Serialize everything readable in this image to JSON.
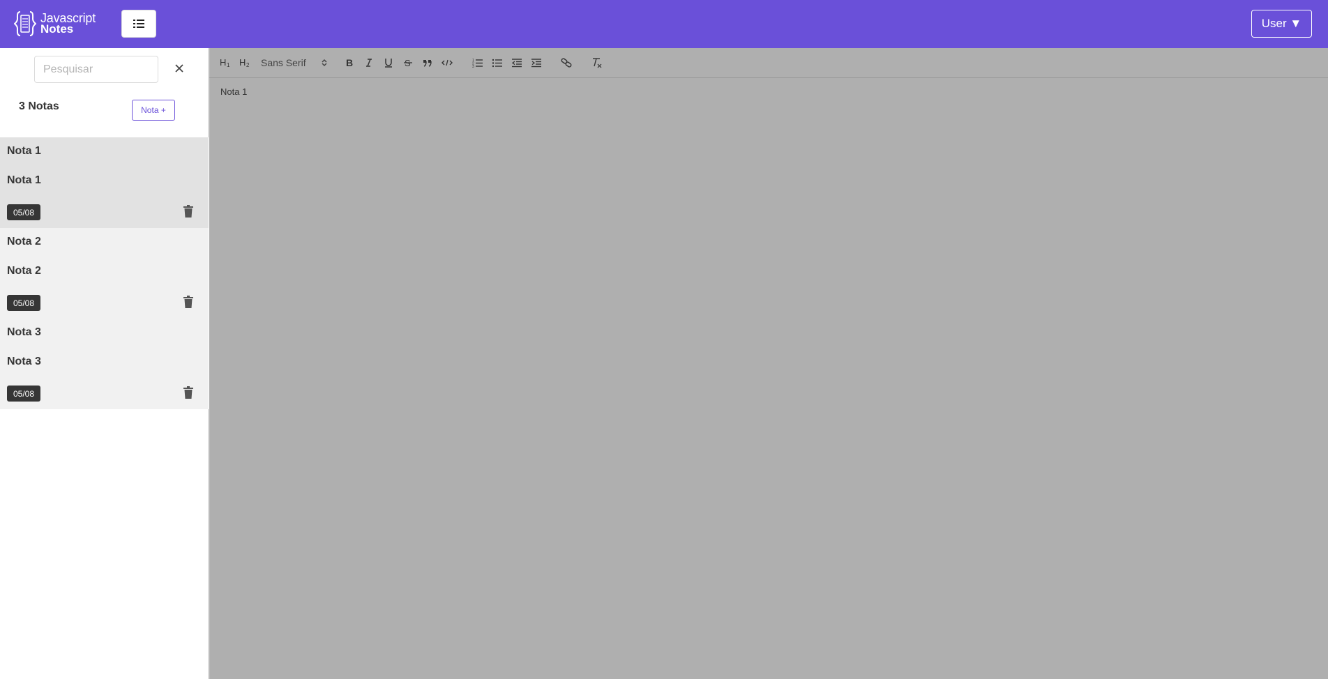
{
  "header": {
    "logo_line1": "Javascript",
    "logo_line2": "Notes",
    "menu_icon": "list-icon",
    "user_label": "User ▼"
  },
  "sidebar": {
    "search_placeholder": "Pesquisar",
    "notes_count_label": "3 Notas",
    "new_note_label": "Nota +",
    "notes": [
      {
        "title": "Nota 1",
        "excerpt": "Nota 1",
        "date": "05/08",
        "active": true
      },
      {
        "title": "Nota 2",
        "excerpt": "Nota 2",
        "date": "05/08",
        "active": false
      },
      {
        "title": "Nota 3",
        "excerpt": "Nota 3",
        "date": "05/08",
        "active": false
      }
    ]
  },
  "editor": {
    "font_family_option": "Sans Serif",
    "content": "Nota 1",
    "toolbar_icons": [
      "header1-icon",
      "header2-icon",
      "bold-icon",
      "italic-icon",
      "underline-icon",
      "strike-icon",
      "blockquote-icon",
      "code-block-icon",
      "ordered-list-icon",
      "bullet-list-icon",
      "indent-decrease-icon",
      "indent-increase-icon",
      "link-icon",
      "clean-format-icon"
    ]
  },
  "colors": {
    "brand": "#6a50d9",
    "editor_bg": "#afafaf",
    "active_note_bg": "#e2e2e2",
    "note_bg": "#f1f1f1",
    "date_badge_bg": "#363636"
  }
}
